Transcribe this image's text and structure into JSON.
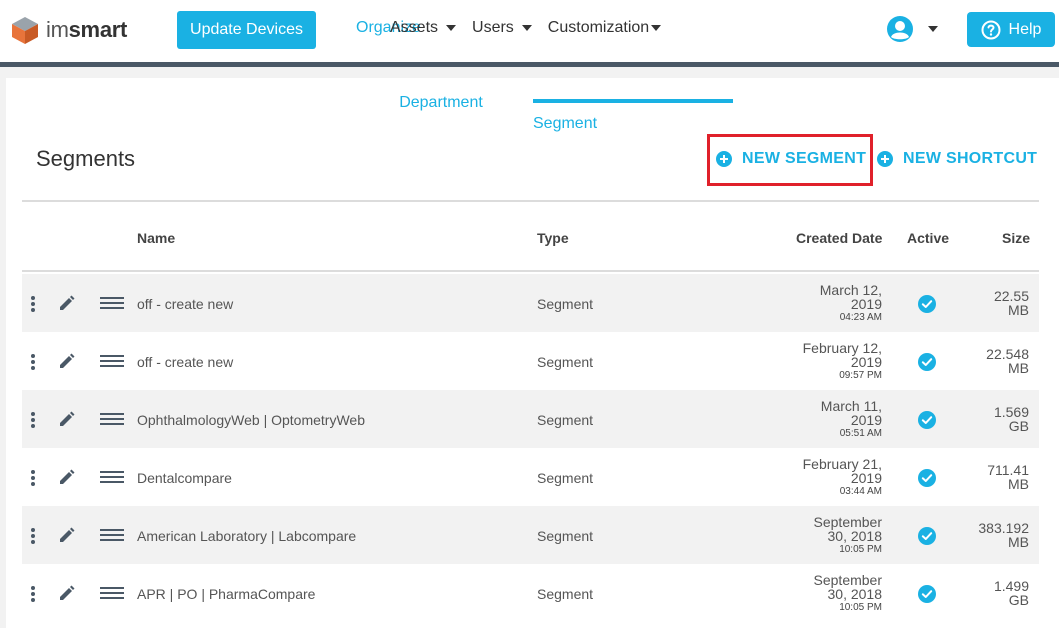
{
  "brand": {
    "name_prefix": "im",
    "name_suffix": "smart",
    "logo_icon": "cube-logo-icon"
  },
  "header": {
    "update_button": "Update Devices",
    "nav": [
      {
        "label": "Organize",
        "active": true,
        "dropdown": false
      },
      {
        "label": "Assets",
        "active": false,
        "dropdown": true
      },
      {
        "label": "Users",
        "active": false,
        "dropdown": true
      },
      {
        "label": "Customization",
        "active": false,
        "dropdown": true
      }
    ],
    "help_button": "Help"
  },
  "tabs": [
    {
      "label": "Department",
      "active": false
    },
    {
      "label": "Segment",
      "active": true
    }
  ],
  "page": {
    "title": "Segments",
    "new_segment": "NEW SEGMENT",
    "new_shortcut": "NEW SHORTCUT"
  },
  "table": {
    "columns": {
      "name": "Name",
      "type": "Type",
      "created": "Created Date",
      "active": "Active",
      "size": "Size"
    },
    "rows": [
      {
        "name": "off - create new",
        "type": "Segment",
        "date_line1": "March 12,",
        "date_line2": "2019",
        "time": "04:23 AM",
        "active": true,
        "size_line1": "22.55",
        "size_line2": "MB"
      },
      {
        "name": "off - create new",
        "type": "Segment",
        "date_line1": "February 12,",
        "date_line2": "2019",
        "time": "09:57 PM",
        "active": true,
        "size_line1": "22.548",
        "size_line2": "MB"
      },
      {
        "name": "OphthalmologyWeb | OptometryWeb",
        "type": "Segment",
        "date_line1": "March 11,",
        "date_line2": "2019",
        "time": "05:51 AM",
        "active": true,
        "size_line1": "1.569",
        "size_line2": "GB"
      },
      {
        "name": "Dentalcompare",
        "type": "Segment",
        "date_line1": "February 21,",
        "date_line2": "2019",
        "time": "03:44 AM",
        "active": true,
        "size_line1": "711.41",
        "size_line2": "MB"
      },
      {
        "name": "American Laboratory | Labcompare",
        "type": "Segment",
        "date_line1": "September",
        "date_line2": "30, 2018",
        "time": "10:05 PM",
        "active": true,
        "size_line1": "383.192",
        "size_line2": "MB"
      },
      {
        "name": "APR | PO | PharmaCompare",
        "type": "Segment",
        "date_line1": "September",
        "date_line2": "30, 2018",
        "time": "10:05 PM",
        "active": true,
        "size_line1": "1.499",
        "size_line2": "GB"
      }
    ]
  },
  "colors": {
    "accent": "#1ab1e3",
    "highlight": "#e0202a",
    "nav_border": "#4a5866"
  }
}
